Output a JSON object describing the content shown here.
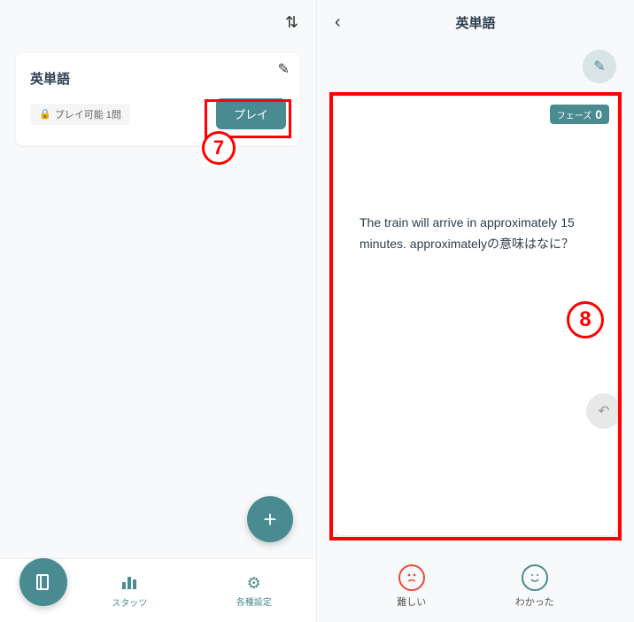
{
  "left": {
    "deck": {
      "title": "英単語",
      "chip_text": "プレイ可能 1問",
      "play_label": "プレイ"
    },
    "nav": {
      "stats_label": "スタッツ",
      "settings_label": "各種設定"
    },
    "annotation_7": "7"
  },
  "right": {
    "header_title": "英単語",
    "phase_label": "フェーズ",
    "phase_value": "0",
    "question": "The train will arrive in approximately 15 minutes. approximatelyの意味はなに？",
    "hard_label": "難しい",
    "easy_label": "わかった",
    "annotation_8": "8"
  }
}
